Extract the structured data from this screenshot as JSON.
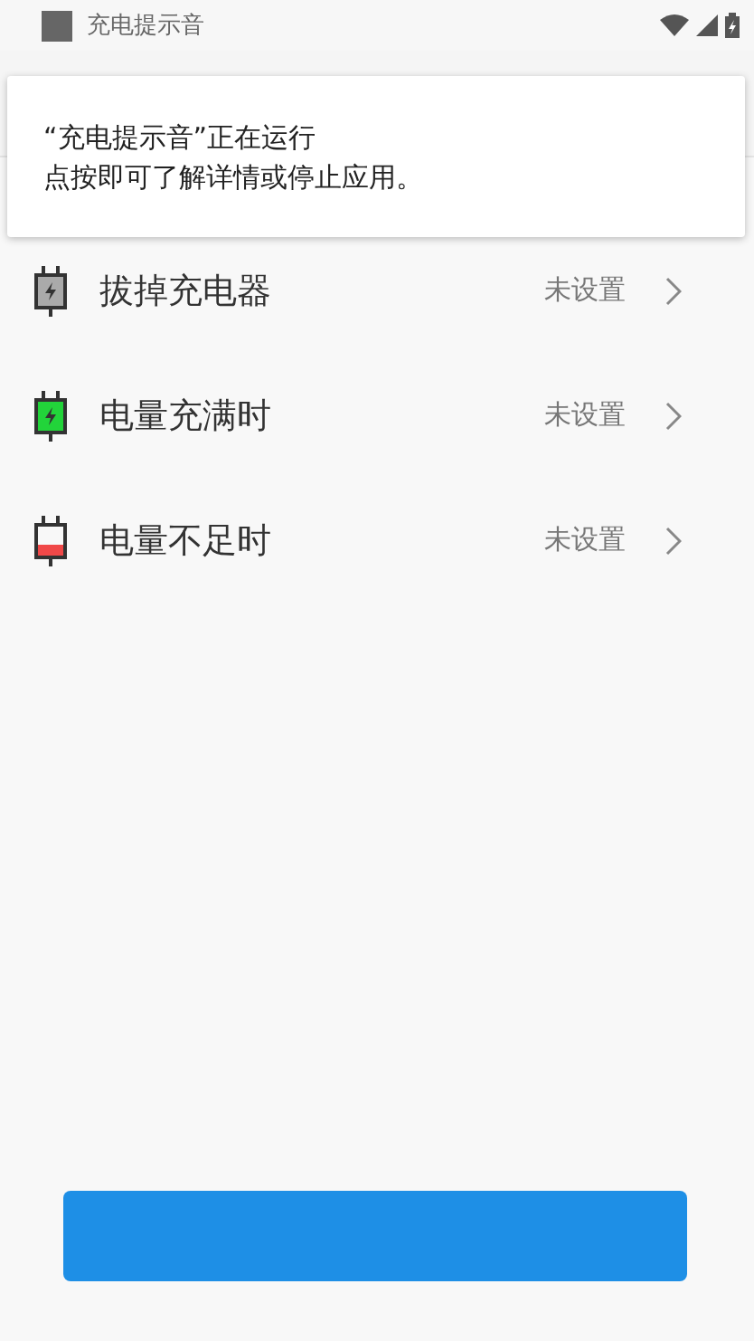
{
  "status_bar": {
    "app_title": "充电提示音"
  },
  "notification": {
    "title": "“充电提示音”正在运行",
    "text": "点按即可了解详情或停止应用。"
  },
  "items": [
    {
      "kind": "unplug",
      "label": "拔掉充电器",
      "value": "未设置"
    },
    {
      "kind": "full",
      "label": "电量充满时",
      "value": "未设置"
    },
    {
      "kind": "low",
      "label": "电量不足时",
      "value": "未设置"
    }
  ],
  "bottom_button": {
    "kind": "primary"
  }
}
